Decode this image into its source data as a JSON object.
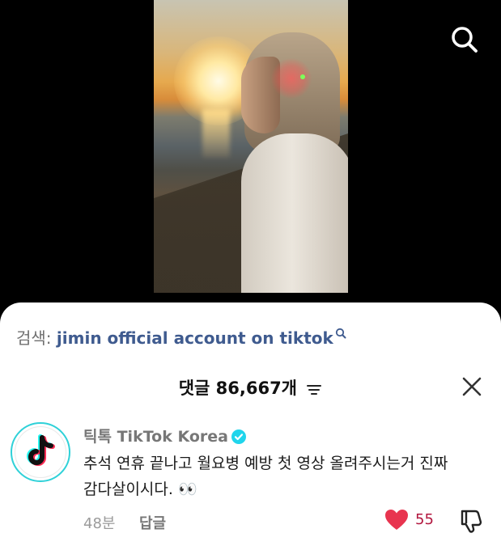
{
  "video": {
    "search_icon": "search-icon"
  },
  "search_suggestion": {
    "prefix": "검색:",
    "query": "jimin official account on tiktok",
    "icon": "search-icon"
  },
  "comments_header": {
    "label": "댓글",
    "count": "86,667개",
    "filter_icon": "sort-filter-icon",
    "close_icon": "close-icon"
  },
  "comment": {
    "avatar_icon": "tiktok-logo-icon",
    "author_korean": "틱톡",
    "author": "TikTok Korea",
    "verified_icon": "verified-check-icon",
    "text": "추석 연휴 끝나고 월요병 예방 첫 영상 올려주시는거 진짜 감다살이시다.",
    "emoji": "👀",
    "time": "48분",
    "reply_label": "답글",
    "like_count": "55",
    "liked": true,
    "colors": {
      "like": "#e8344f",
      "verified": "#20d5ec",
      "search_query": "#3f5b8f"
    }
  }
}
